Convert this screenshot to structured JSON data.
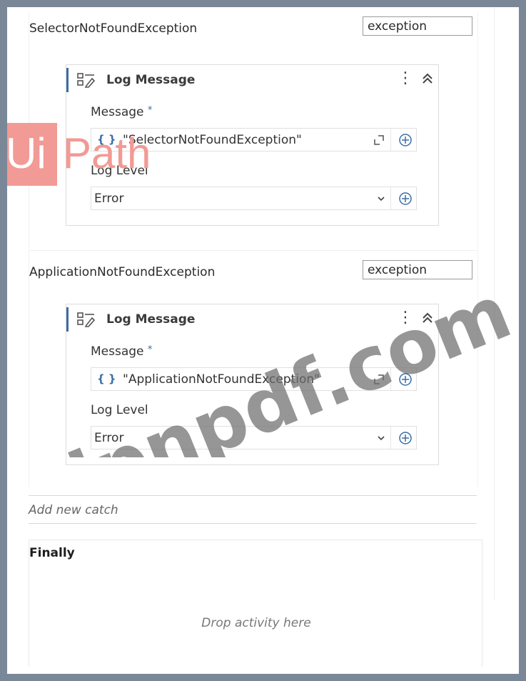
{
  "brand": {
    "logo_ui": "Ui",
    "logo_path": "Path"
  },
  "watermark": "jpnpdf.com",
  "catches": [
    {
      "exception_type": "SelectorNotFoundException",
      "variable": "exception",
      "activity": {
        "title": "Log Message",
        "message_label": "Message",
        "required_mark": "*",
        "message_value": "\"SelectorNotFoundException\"",
        "level_label": "Log Level",
        "level_value": "Error"
      }
    },
    {
      "exception_type": "ApplicationNotFoundException",
      "variable": "exception",
      "activity": {
        "title": "Log Message",
        "message_label": "Message",
        "required_mark": "*",
        "message_value": "\"ApplicationNotFoundException\"",
        "level_label": "Log Level",
        "level_value": "Error"
      }
    }
  ],
  "add_catch_label": "Add new catch",
  "finally": {
    "title": "Finally",
    "drop_hint": "Drop activity here"
  },
  "icons": {
    "activity": "log-message-icon",
    "menu": "more-vertical-icon",
    "collapse": "double-chevron-up-icon",
    "expression": "braces-icon",
    "expand": "expand-icon",
    "add": "plus-circle-icon",
    "dropdown": "chevron-down-icon"
  },
  "colors": {
    "accent": "#3a6ea5",
    "logo": "#f29a95"
  }
}
